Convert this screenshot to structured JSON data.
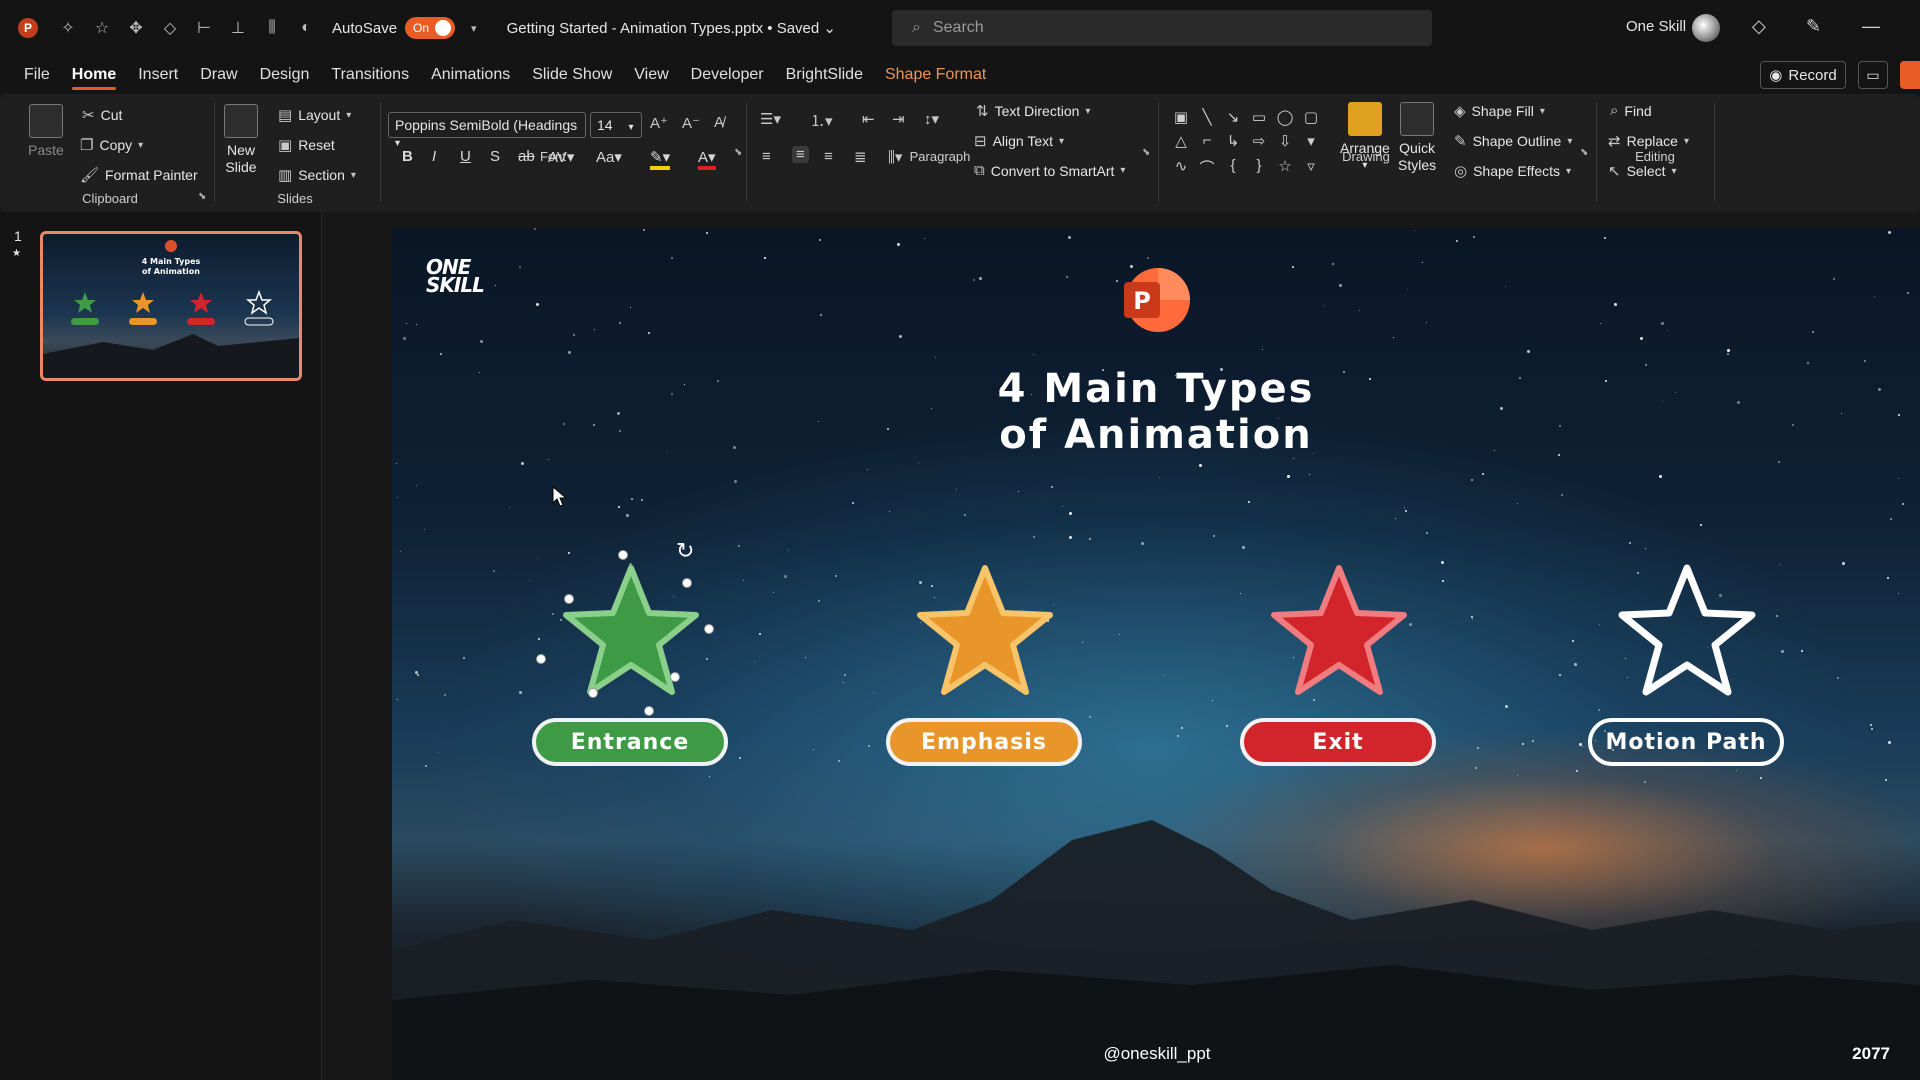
{
  "titlebar": {
    "autosave_label": "AutoSave",
    "autosave_state": "On",
    "doc_title": "Getting Started - Animation Types.pptx • Saved",
    "search_placeholder": "Search",
    "user_name": "One Skill"
  },
  "menu": {
    "tabs": [
      "File",
      "Home",
      "Insert",
      "Draw",
      "Design",
      "Transitions",
      "Animations",
      "Slide Show",
      "View",
      "Developer",
      "BrightSlide",
      "Shape Format"
    ],
    "active": "Home",
    "record_label": "Record"
  },
  "ribbon": {
    "clipboard": {
      "paste": "Paste",
      "cut": "Cut",
      "copy": "Copy",
      "format_painter": "Format Painter",
      "label": "Clipboard"
    },
    "slides": {
      "new_slide_1": "New",
      "new_slide_2": "Slide",
      "layout": "Layout",
      "reset": "Reset",
      "section": "Section",
      "label": "Slides"
    },
    "font": {
      "family": "Poppins SemiBold (Headings",
      "size": "14",
      "label": "Font"
    },
    "paragraph": {
      "text_direction": "Text Direction",
      "align_text": "Align Text",
      "convert_smartart": "Convert to SmartArt",
      "label": "Paragraph"
    },
    "drawing": {
      "arrange": "Arrange",
      "quick_styles_1": "Quick",
      "quick_styles_2": "Styles",
      "shape_fill": "Shape Fill",
      "shape_outline": "Shape Outline",
      "shape_effects": "Shape Effects",
      "label": "Drawing"
    },
    "editing": {
      "find": "Find",
      "replace": "Replace",
      "select": "Select",
      "label": "Editing"
    }
  },
  "slide_panel": {
    "slide_number": "1"
  },
  "slide": {
    "logo_line1": "ONE",
    "logo_line2": "SKILL",
    "ppt_letter": "P",
    "title_line1": "4 Main Types",
    "title_line2": "of Animation",
    "items": [
      {
        "label": "Entrance",
        "color": "#3e9a45"
      },
      {
        "label": "Emphasis",
        "color": "#e8952a"
      },
      {
        "label": "Exit",
        "color": "#d1252b"
      },
      {
        "label": "Motion Path",
        "color": "none"
      }
    ],
    "footer_handle": "@oneskill_ppt",
    "page_number": "2077"
  }
}
